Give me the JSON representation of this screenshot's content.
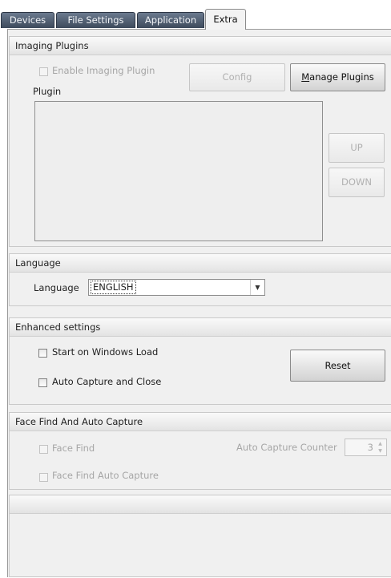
{
  "tabs": [
    {
      "label": "Devices"
    },
    {
      "label": "File Settings"
    },
    {
      "label": "Application"
    },
    {
      "label": "Extra"
    }
  ],
  "imaging_plugins": {
    "header": "Imaging Plugins",
    "enable_label": "Enable Imaging Plugin",
    "config_button": "Config",
    "manage_button_accel": "M",
    "manage_button_rest": "anage Plugins",
    "plugin_label": "Plugin",
    "up_button": "UP",
    "down_button": "DOWN"
  },
  "language": {
    "header": "Language",
    "label": "Language",
    "selected": "ENGLISH"
  },
  "enhanced": {
    "header": "Enhanced settings",
    "start_on_windows": "Start on Windows Load",
    "auto_capture_close": "Auto Capture and Close",
    "reset_button": "Reset"
  },
  "face_find": {
    "header": "Face Find And Auto Capture",
    "face_find_label": "Face Find",
    "auto_capture_counter_label": "Auto Capture Counter",
    "counter_value": "3",
    "face_find_auto_capture_label": "Face Find Auto Capture"
  },
  "bottom_group": {
    "header": ""
  }
}
